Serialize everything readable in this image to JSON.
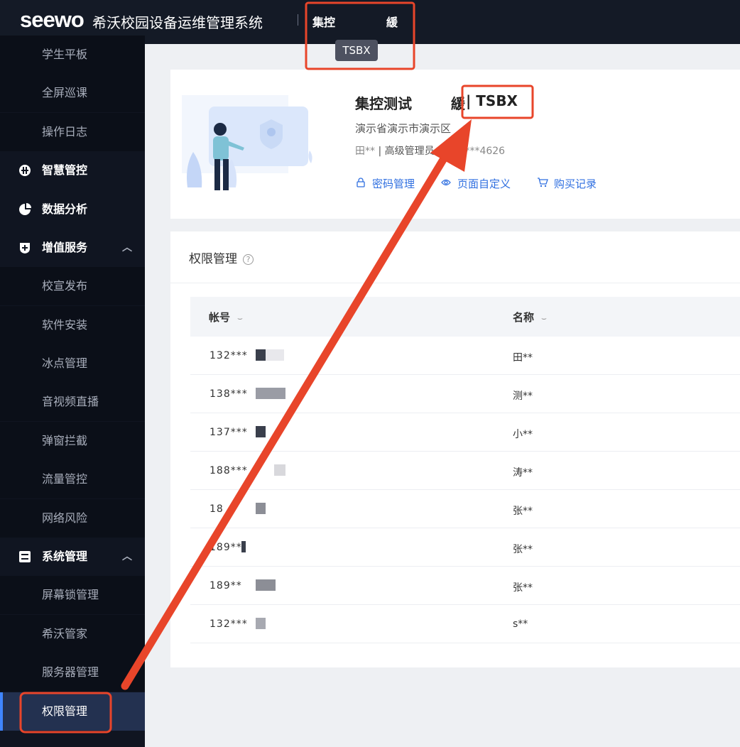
{
  "header": {
    "logo": "seewo",
    "system_title": "希沃校园设备运维管理系统",
    "tenant_prefix": "集控",
    "tenant_suffix": "緩",
    "tooltip": "TSBX"
  },
  "sidebar": {
    "items": [
      {
        "label": "学生平板",
        "type": "child"
      },
      {
        "label": "全屏巡课",
        "type": "child"
      },
      {
        "label": "操作日志",
        "type": "child"
      },
      {
        "label": "智慧管控",
        "type": "group",
        "icon": "control-icon"
      },
      {
        "label": "数据分析",
        "type": "group",
        "icon": "pie-chart-icon"
      },
      {
        "label": "增值服务",
        "type": "group",
        "icon": "plus-shield-icon",
        "caret": "^"
      },
      {
        "label": "校宣发布",
        "type": "child"
      },
      {
        "label": "软件安装",
        "type": "child"
      },
      {
        "label": "冰点管理",
        "type": "child"
      },
      {
        "label": "音视频直播",
        "type": "child"
      },
      {
        "label": "弹窗拦截",
        "type": "child"
      },
      {
        "label": "流量管控",
        "type": "child"
      },
      {
        "label": "网络风险",
        "type": "child"
      },
      {
        "label": "系统管理",
        "type": "group",
        "icon": "switch-icon",
        "caret": "^"
      },
      {
        "label": "屏幕锁管理",
        "type": "child"
      },
      {
        "label": "希沃管家",
        "type": "child"
      },
      {
        "label": "服务器管理",
        "type": "child"
      },
      {
        "label": "权限管理",
        "type": "child",
        "active": true
      }
    ]
  },
  "org": {
    "name_prefix": "集控测试",
    "name_tail": "緩",
    "code": "| TSBX",
    "region": "演示省演示市演示区",
    "user_name": "田**",
    "user_role": "| 高级管理员",
    "phone_tail": "2****4626",
    "links": [
      {
        "label": "密码管理",
        "icon": "lock-icon"
      },
      {
        "label": "页面自定义",
        "icon": "eye-icon"
      },
      {
        "label": "购买记录",
        "icon": "cart-icon"
      }
    ]
  },
  "permissions": {
    "title": "权限管理",
    "help_icon": "?",
    "columns": [
      "帐号",
      "名称"
    ],
    "eye_glyph": "⌣",
    "rows": [
      {
        "account": "132***",
        "name": "田**"
      },
      {
        "account": "138***",
        "name": "测**"
      },
      {
        "account": "137***",
        "name": "小**"
      },
      {
        "account": "188***",
        "name": "涛**"
      },
      {
        "account": "18",
        "name": "张**"
      },
      {
        "account": "189**",
        "name": "张**"
      },
      {
        "account": "189**",
        "name": "张**"
      },
      {
        "account": "132***",
        "name": "s**"
      }
    ]
  },
  "colors": {
    "annotation": "#e8452a",
    "accent": "#2f6fe0",
    "sidebar_bg": "#101521",
    "active_bg": "#233150"
  }
}
